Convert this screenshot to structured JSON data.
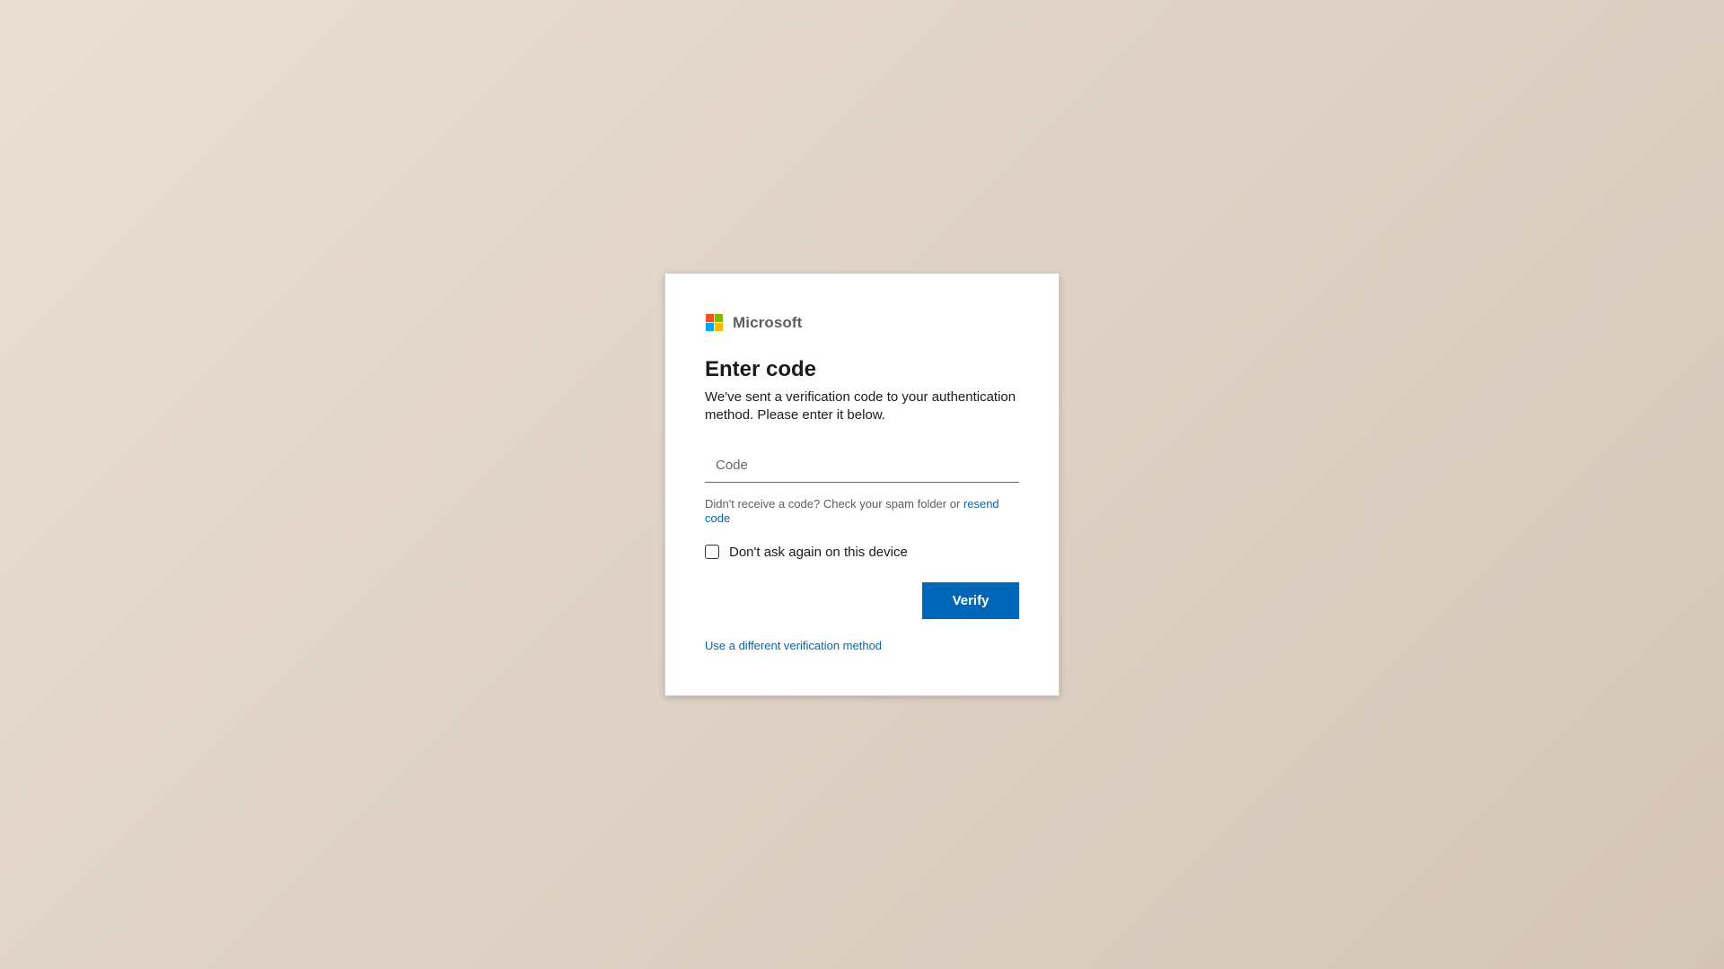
{
  "brand": {
    "name": "Microsoft",
    "logo_colors": [
      "#f25022",
      "#7fba00",
      "#00a4ef",
      "#ffb900"
    ]
  },
  "form": {
    "title": "Enter code",
    "description": "We've sent a verification code to your authentication method. Please enter it below.",
    "code_input": {
      "placeholder": "Code",
      "value": ""
    },
    "hint_text": "Didn't receive a code? Check your spam folder or ",
    "resend_link": "resend code",
    "remember_checkbox": {
      "label": "Don't ask again on this device",
      "checked": false
    },
    "verify_button": "Verify",
    "alt_method_link": "Use a different verification method"
  },
  "colors": {
    "accent": "#0067b8",
    "text": "#1b1b1b",
    "muted": "#5e5e5e"
  }
}
